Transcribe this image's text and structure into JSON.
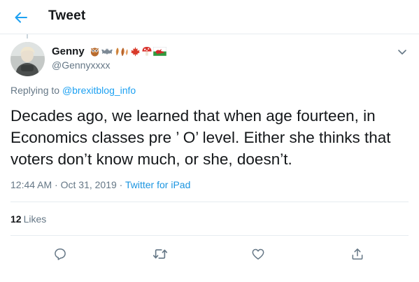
{
  "header": {
    "title": "Tweet"
  },
  "author": {
    "name": "Genny",
    "handle": "@Gennyxxxx",
    "name_emojis": [
      "owl",
      "bat",
      "leaves",
      "maple-leaf",
      "mushroom",
      "wales-flag"
    ]
  },
  "reply": {
    "prefix": "Replying to ",
    "target": "@brexitblog_info"
  },
  "tweet": {
    "text": "Decades ago, we learned that when age fourteen, in Economics classes pre ’ O’ level. Either she thinks that voters don’t know much, or she, doesn’t.",
    "time": "12:44 AM",
    "date": "Oct 31, 2019",
    "separator": "·",
    "source": "Twitter for iPad"
  },
  "stats": {
    "likes_count": "12",
    "likes_label": "Likes"
  },
  "actions": [
    "reply-icon",
    "retweet-icon",
    "like-icon",
    "share-icon"
  ],
  "colors": {
    "accent": "#1da1f2",
    "text": "#14171a",
    "muted": "#657786",
    "border": "#e6ecf0"
  }
}
